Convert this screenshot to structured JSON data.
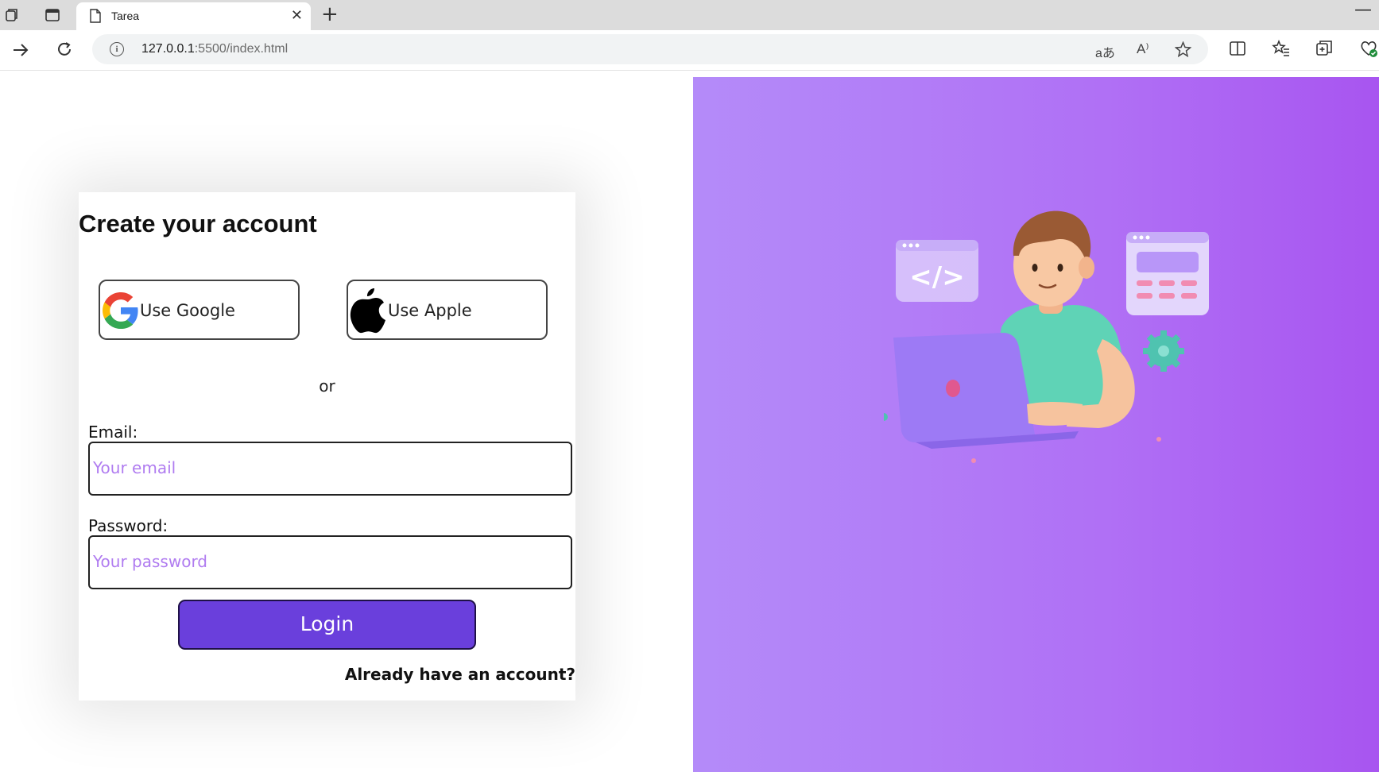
{
  "browser": {
    "tab_title": "Tarea",
    "url_host": "127.0.0.1",
    "url_path": ":5500/index.html",
    "close_glyph": "✕",
    "new_tab_glyph": "+",
    "minimize_glyph": "—"
  },
  "form": {
    "title": "Create your account",
    "google_label": "Use Google",
    "apple_label": "Use Apple",
    "or_text": "or",
    "email_label": "Email:",
    "email_placeholder": "Your email",
    "password_label": "Password:",
    "password_placeholder": "Your password",
    "login_label": "Login",
    "already_label": "Already have an account?"
  },
  "illustration": {
    "code_symbol": "</>"
  },
  "colors": {
    "accent": "#6a3fdc",
    "placeholder": "#b07cf0",
    "hero_gradient_start": "#b48bf9",
    "hero_gradient_end": "#a855f0"
  }
}
